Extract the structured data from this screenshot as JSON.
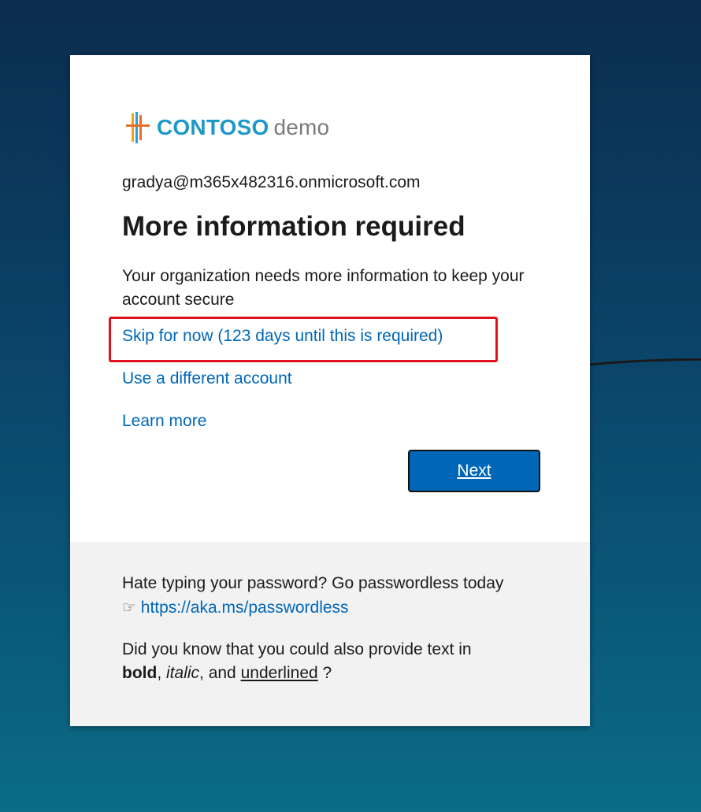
{
  "colors": {
    "accent": "#0067b8",
    "highlight": "#e0111c",
    "logo_blue": "#1f97c9",
    "logo_gray": "#7b7b7b",
    "footer_bg": "#f2f2f2"
  },
  "logo": {
    "icon": "contoso-logo-icon",
    "brand": "CONTOSO",
    "suffix": "demo"
  },
  "identity": "gradya@m365x482316.onmicrosoft.com",
  "title": "More information required",
  "description": "Your organization needs more information to keep your account secure",
  "links": {
    "skip": "Skip for now (123 days until this is required)",
    "different_account": "Use a different account",
    "learn_more": "Learn more"
  },
  "next_button": "Next",
  "footer": {
    "para1_text": "Hate typing your password? Go passwordless today",
    "para1_icon": "☞",
    "para1_link": "https://aka.ms/passwordless",
    "para2_prefix": "Did you know that you could also provide text in",
    "para2_bold": "bold",
    "para2_sep1": ",",
    "para2_italic": "italic",
    "para2_sep2": ", and",
    "para2_underlined": "underlined",
    "para2_suffix": "?"
  }
}
